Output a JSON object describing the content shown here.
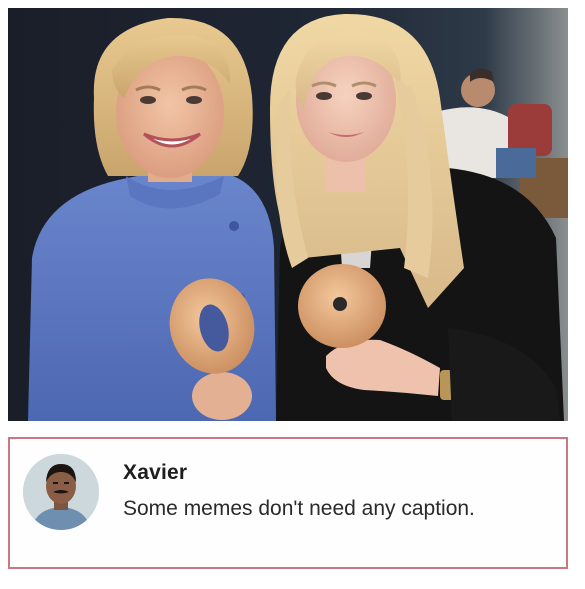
{
  "photo": {
    "subject": "two people holding donuts"
  },
  "comment": {
    "avatar_icon": "user-avatar",
    "name": "Xavier",
    "text": "Some memes don't need any caption."
  },
  "colors": {
    "card_border": "#c97880",
    "name_text": "#1e1e1e",
    "body_text": "#2a2a2a"
  }
}
